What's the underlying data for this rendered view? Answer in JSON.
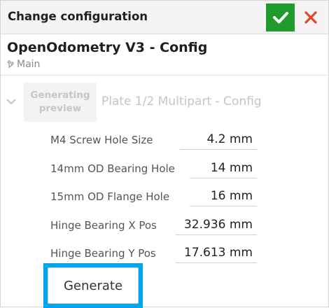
{
  "dialog": {
    "title": "Change configuration",
    "ok_icon": "check-icon",
    "cancel_icon": "close-icon",
    "colors": {
      "ok": "#1f9a2c",
      "cancel": "#e0452a",
      "highlight": "#00a5ec"
    }
  },
  "document": {
    "name": "OpenOdometry V3 - Config",
    "branch_icon": "branch-icon",
    "branch": "Main"
  },
  "part": {
    "chevron_icon": "chevron-down-icon",
    "thumbnail_line1": "Generating",
    "thumbnail_line2": "preview",
    "name": "Plate 1/2 Multipart - Config"
  },
  "parameters": [
    {
      "label": "M4 Screw Hole Size",
      "value": "4.2 mm"
    },
    {
      "label": "14mm OD Bearing Hole",
      "value": "14 mm"
    },
    {
      "label": "15mm OD Flange Hole",
      "value": "16 mm"
    },
    {
      "label": "Hinge Bearing X Pos",
      "value": "32.936 mm"
    },
    {
      "label": "Hinge Bearing Y Pos",
      "value": "17.613 mm"
    }
  ],
  "actions": {
    "generate_label": "Generate"
  }
}
